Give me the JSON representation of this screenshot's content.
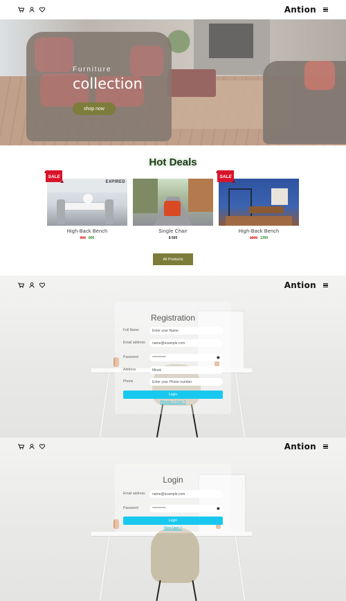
{
  "header": {
    "brand": "Antion",
    "icons": [
      "cart-icon",
      "user-icon",
      "heart-icon",
      "menu-icon"
    ]
  },
  "hero": {
    "subtitle": "Furniture",
    "title": "collection",
    "button": "shop now"
  },
  "deals": {
    "title": "Hot Deals",
    "products": [
      {
        "name": "High-Back Bench",
        "old_price": "900",
        "new_price": "800",
        "badge": "SALE",
        "status": "EXPIRED"
      },
      {
        "name": "Single Chair",
        "price": "$ 500"
      },
      {
        "name": "High-Back Bench",
        "old_price": "1600",
        "new_price": "1300",
        "badge": "SALE"
      }
    ],
    "all_button": "All Products"
  },
  "registration": {
    "title": "Registration",
    "fields": [
      {
        "label": "Full Name",
        "placeholder": "Enter your Name"
      },
      {
        "label": "Email address",
        "placeholder": "name@example.com"
      },
      {
        "label": "Password",
        "value": "**********"
      },
      {
        "label": "Address",
        "value": "Minsk"
      },
      {
        "label": "Phone",
        "placeholder": "Enter your Phone number"
      }
    ],
    "submit": "Login",
    "link": "Already a User ?"
  },
  "login": {
    "title": "Login",
    "fields": [
      {
        "label": "Email address",
        "placeholder": "name@example.com"
      },
      {
        "label": "Password",
        "value": "**********"
      }
    ],
    "submit": "Login",
    "link": "New User ?"
  },
  "colors": {
    "accent_olive": "#7d7c3a",
    "cyan": "#19c8ef",
    "sale_red": "#d9142a",
    "old_price": "#d33",
    "new_price": "#2a8a2a"
  }
}
